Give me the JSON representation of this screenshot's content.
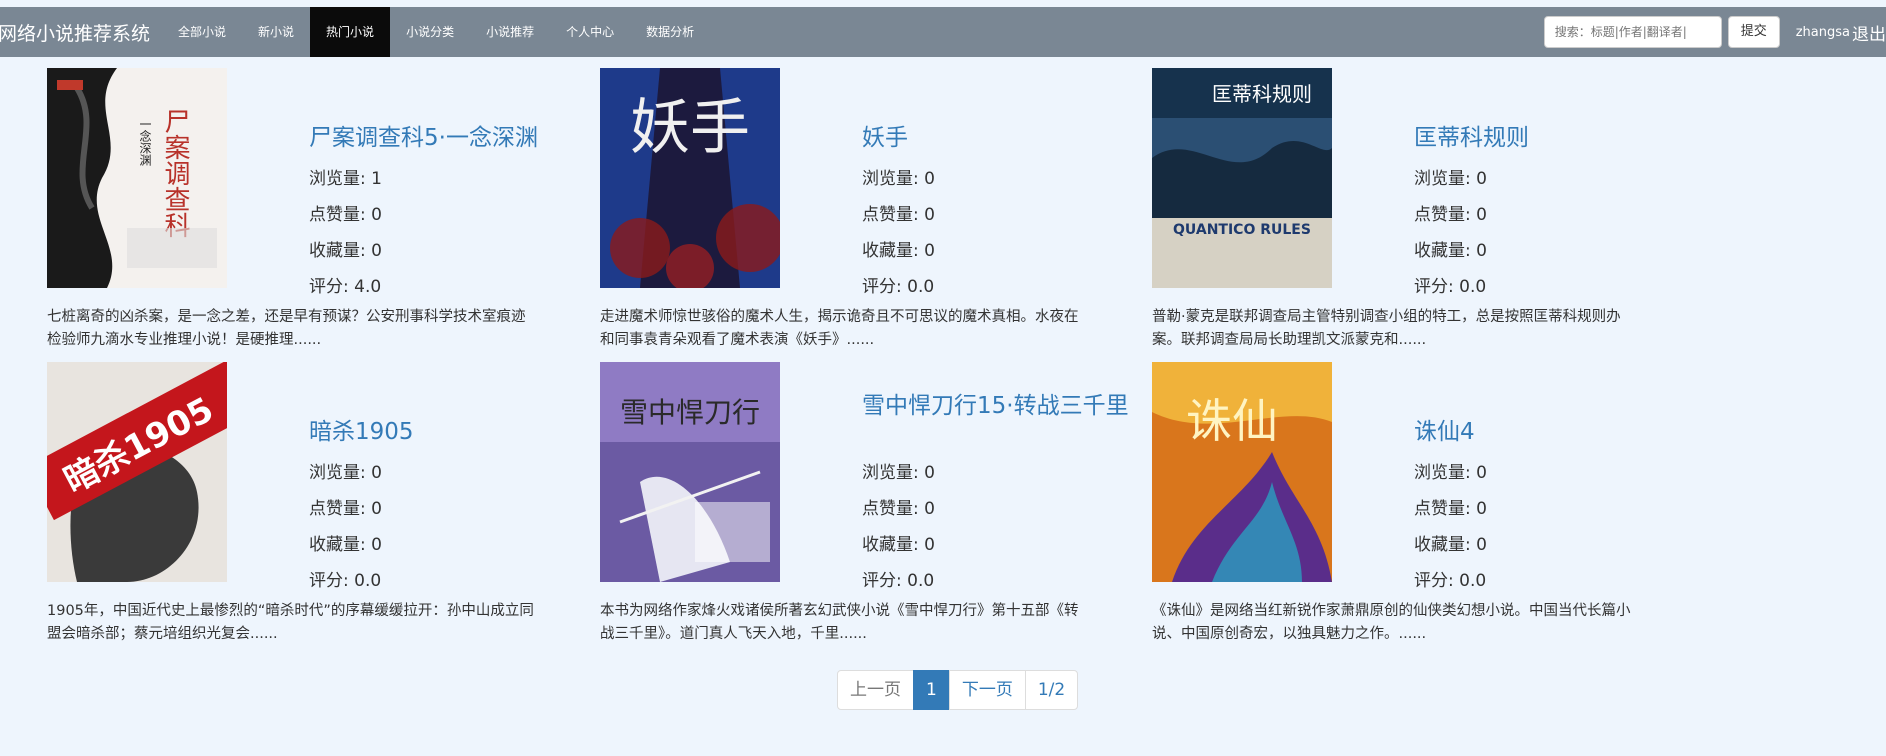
{
  "nav": {
    "brand": "网络小说推荐系统",
    "items": [
      "全部小说",
      "新小说",
      "热门小说",
      "小说分类",
      "小说推荐",
      "个人中心",
      "数据分析"
    ],
    "active_index": 2,
    "search_placeholder": "搜索：标题|作者|翻译者|",
    "submit_label": "提交",
    "username": "zhangsa",
    "logout_label": "退出"
  },
  "labels": {
    "views": "浏览量: ",
    "likes": "点赞量: ",
    "favorites": "收藏量: ",
    "rating": "评分: "
  },
  "books": [
    {
      "title": "尸案调查科5·一念深渊",
      "views": "1",
      "likes": "0",
      "favorites": "0",
      "rating": "4.0",
      "desc": "七桩离奇的凶杀案，是一念之差，还是早有预谋？公安刑事科学技术室痕迹检验师九滴水专业推理小说！是硬推理......"
    },
    {
      "title": "妖手",
      "views": "0",
      "likes": "0",
      "favorites": "0",
      "rating": "0.0",
      "desc": "走进魔术师惊世骇俗的魔术人生，揭示诡奇且不可思议的魔术真相。水夜在和同事袁青朵观看了魔术表演《妖手》......"
    },
    {
      "title": "匡蒂科规则",
      "views": "0",
      "likes": "0",
      "favorites": "0",
      "rating": "0.0",
      "desc": "普勒·蒙克是联邦调查局主管特别调查小组的特工，总是按照匡蒂科规则办案。联邦调查局局长助理凯文派蒙克和......"
    },
    {
      "title": "暗杀1905",
      "views": "0",
      "likes": "0",
      "favorites": "0",
      "rating": "0.0",
      "desc": "1905年，中国近代史上最惨烈的“暗杀时代”的序幕缓缓拉开：孙中山成立同盟会暗杀部；蔡元培组织光复会......"
    },
    {
      "title": "雪中悍刀行15·转战三千里",
      "views": "0",
      "likes": "0",
      "favorites": "0",
      "rating": "0.0",
      "desc": "本书为网络作家烽火戏诸侯所著玄幻武侠小说《雪中悍刀行》第十五部《转战三千里》。道门真人飞天入地，千里......"
    },
    {
      "title": "诛仙4",
      "views": "0",
      "likes": "0",
      "favorites": "0",
      "rating": "0.0",
      "desc": "《诛仙》是网络当红新锐作家萧鼎原创的仙侠类幻想小说。中国当代长篇小说、中国原创奇宏，以独具魅力之作。......"
    }
  ],
  "covers": [
    {
      "text": "尸案调查科",
      "sub": "一念深渊"
    },
    {
      "text": "妖手"
    },
    {
      "text": "匡蒂科规则",
      "sub": "QUANTICO RULES"
    },
    {
      "text": "暗杀1905"
    },
    {
      "text": "雪中悍刀行"
    },
    {
      "text": "诛仙"
    }
  ],
  "pager": {
    "prev": "上一页",
    "current": "1",
    "next": "下一页",
    "info": "1/2"
  }
}
